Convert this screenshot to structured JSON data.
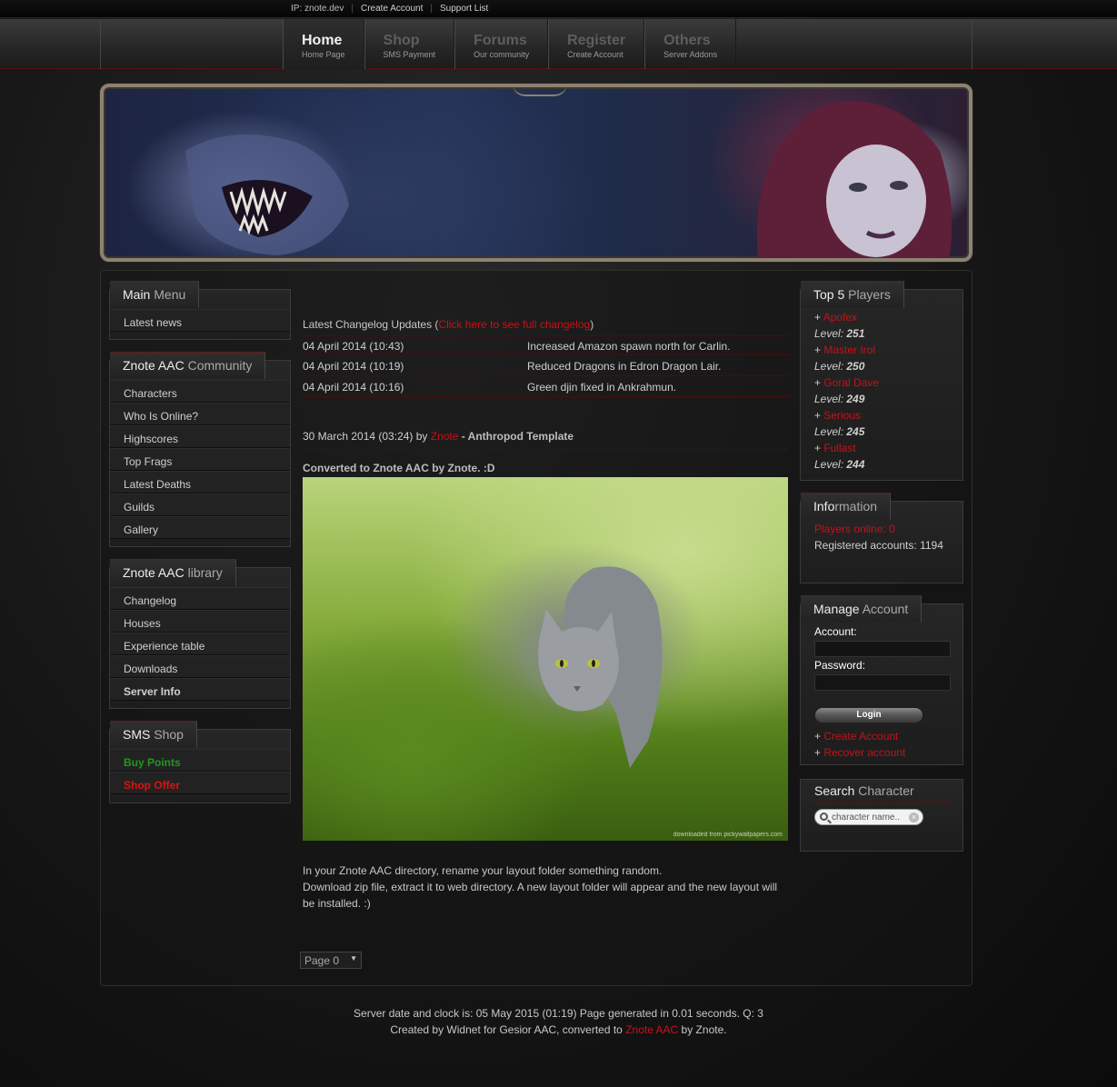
{
  "topbar": {
    "ip": "IP: znote.dev",
    "create_account": "Create Account",
    "support_list": "Support List"
  },
  "nav": [
    {
      "label": "Home",
      "sub": "Home Page"
    },
    {
      "label": "Shop",
      "sub": "SMS Payment"
    },
    {
      "label": "Forums",
      "sub": "Our community"
    },
    {
      "label": "Register",
      "sub": "Create Account"
    },
    {
      "label": "Others",
      "sub": "Server Addons"
    }
  ],
  "left": {
    "main_menu": {
      "title_bold": "Main",
      "title_rest": " Menu",
      "items": [
        "Latest news"
      ]
    },
    "community": {
      "title_bold": "Znote AAC",
      "title_rest": " Community",
      "items": [
        "Characters",
        "Who Is Online?",
        "Highscores",
        "Top Frags",
        "Latest Deaths",
        "Guilds",
        "Gallery"
      ]
    },
    "library": {
      "title_bold": "Znote AAC",
      "title_rest": " library",
      "items": [
        "Changelog",
        "Houses",
        "Experience table",
        "Downloads",
        "Server Info"
      ]
    },
    "sms_shop": {
      "title_bold": "SMS",
      "title_rest": " Shop",
      "items": [
        "Buy Points",
        "Shop Offer"
      ]
    }
  },
  "changelog": {
    "heading": "Latest Changelog Updates (",
    "link": "Click here to see full changelog",
    "heading_end": ")",
    "rows": [
      {
        "date": "04 April 2014 (10:43)",
        "msg": "Increased Amazon spawn north for Carlin."
      },
      {
        "date": "04 April 2014 (10:19)",
        "msg": "Reduced Dragons in Edron Dragon Lair."
      },
      {
        "date": "04 April 2014 (10:16)",
        "msg": "Green djin fixed in Ankrahmun."
      }
    ]
  },
  "post": {
    "date": "30 March 2014 (03:24) by ",
    "author": "Znote",
    "title": " - Anthropod Template",
    "subtitle": "Converted to Znote AAC by Znote. :D",
    "image_credit": "downloaded from pickywallpapers.com",
    "body_1": "In your Znote AAC directory, rename your layout folder something random.",
    "body_2": "Download zip file, extract it to web directory. A new layout folder will appear and the new layout will",
    "body_3": "be installed. :)"
  },
  "pagination": {
    "selected": "Page 0"
  },
  "right": {
    "top5": {
      "title_bold": "Top 5",
      "title_rest": " Players",
      "players": [
        {
          "name": "Apofex",
          "level_label": "Level:",
          "level": "251"
        },
        {
          "name": "Master Irol",
          "level_label": "Level:",
          "level": "250"
        },
        {
          "name": "Goral Dave",
          "level_label": "Level:",
          "level": "249"
        },
        {
          "name": "Serious",
          "level_label": "Level:",
          "level": "245"
        },
        {
          "name": "Fullast",
          "level_label": "Level:",
          "level": "244"
        }
      ]
    },
    "info": {
      "title_bold": "Info",
      "title_rest": "rmation",
      "players_online": "Players online: 0",
      "registered": "Registered accounts: 1194"
    },
    "manage": {
      "title_bold": "Manage",
      "title_rest": " Account",
      "account_label": "Account:",
      "password_label": "Password:",
      "login": "Login",
      "create": "Create Account",
      "recover": "Recover account"
    },
    "search": {
      "title_bold": "Search",
      "title_rest": " Character",
      "placeholder": "character name.."
    }
  },
  "footer": {
    "line1": "Server date and clock is: 05 May 2015 (01:19) Page generated in 0.01 seconds. Q: 3",
    "line2_a": "Created by Widnet for Gesior AAC, converted to ",
    "line2_link": "Znote AAC",
    "line2_b": " by Znote."
  },
  "colors": {
    "accent_red": "#c4121b",
    "buy_points": "#1e9a1e",
    "shop_offer": "#e01010"
  }
}
